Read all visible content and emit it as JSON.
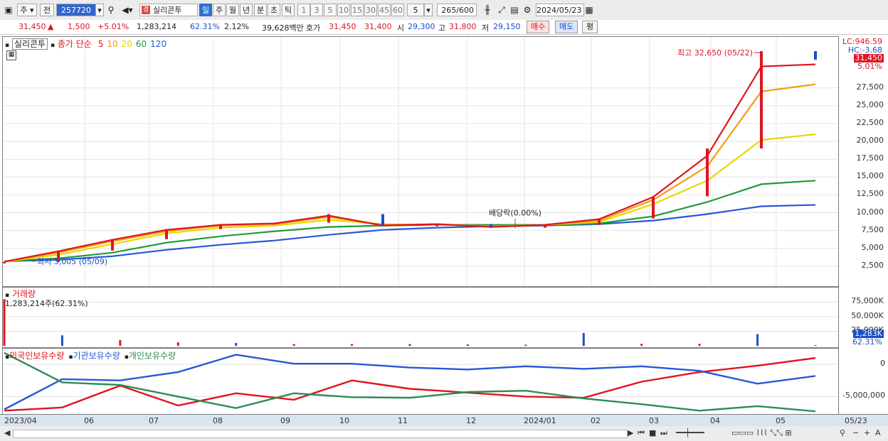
{
  "toolbar": {
    "kind": "주",
    "prev": "전",
    "code": "257720",
    "stock_name": "실리콘투",
    "periods": [
      "일",
      "주",
      "월",
      "년",
      "분",
      "초",
      "틱"
    ],
    "selected_period": "일",
    "intervals": [
      "1",
      "3",
      "5",
      "10",
      "15",
      "30",
      "45",
      "60"
    ],
    "interval_value": "5",
    "count": "265",
    "count_total": "/600",
    "date": "2024/05/23"
  },
  "quote": {
    "price": "31,450",
    "arrow": "▲",
    "change": "1,500",
    "change_pct": "+5.01%",
    "volume": "1,283,214",
    "turnover_pct": "62.31%",
    "ratio": "2.12%",
    "amount": "39,628백만",
    "hoga_label": "호가",
    "ask": "31,450",
    "bid": "31,400",
    "open_label": "시",
    "open": "29,300",
    "high_label": "고",
    "high": "31,800",
    "low_label": "저",
    "low": "29,150",
    "buy_btn": "매수",
    "sell_btn": "매도",
    "eval_btn": "평"
  },
  "price_legend": {
    "name": "실리콘투",
    "ma_label": "종가 단순",
    "ma_periods": [
      {
        "p": "5",
        "color": "#e0141e"
      },
      {
        "p": "10",
        "color": "#f39c12"
      },
      {
        "p": "20",
        "color": "#e6d800"
      },
      {
        "p": "60",
        "color": "#1e9b3a"
      },
      {
        "p": "120",
        "color": "#2a56d6"
      }
    ]
  },
  "price_axis": {
    "lc": "LC:946.59",
    "hc": "HC:-3.68",
    "last": "31,450",
    "pct": "5.01%",
    "ticks": [
      "27,500",
      "25,000",
      "22,500",
      "20,000",
      "17,500",
      "15,000",
      "12,500",
      "10,000",
      "7,500",
      "5,000",
      "2,500"
    ]
  },
  "annotations": {
    "high": "최고 32,650 (05/22)",
    "low": "최저 3,005 (05/09)",
    "dividend": "배당락(0.00%)"
  },
  "volume_pane": {
    "title": "거래량",
    "value": "1,283,214주(62.31%)",
    "ticks": [
      "75,000K",
      "50,000K",
      "25,000K"
    ],
    "last": "1,283K",
    "pct": "62.31%"
  },
  "holdings_pane": {
    "series": [
      {
        "name": "외국인보유수량",
        "color": "#e0141e"
      },
      {
        "name": "기관보유수량",
        "color": "#2a56d6"
      },
      {
        "name": "개인보유수량",
        "color": "#2e8b57"
      }
    ],
    "ticks": [
      "0",
      "-5,000,000"
    ]
  },
  "x_labels": [
    "2023/04",
    "06",
    "07",
    "08",
    "09",
    "10",
    "11",
    "12",
    "2024/01",
    "02",
    "03",
    "04",
    "05",
    "05/23"
  ],
  "chart_data": [
    {
      "type": "line",
      "title": "실리콘투",
      "x": [
        "2023/04",
        "2023/05",
        "2023/06",
        "2023/07",
        "2023/08",
        "2023/09",
        "2023/10",
        "2023/11",
        "2023/12",
        "2024/01",
        "2024/02",
        "2024/03",
        "2024/04",
        "2024/05",
        "2024/05/22",
        "2024/05/23"
      ],
      "series": [
        {
          "name": "종가",
          "values": [
            3100,
            4700,
            6300,
            7700,
            8400,
            8600,
            9800,
            8100,
            8400,
            7900,
            8300,
            9200,
            12300,
            19000,
            32650,
            31450
          ]
        },
        {
          "name": "5",
          "values": [
            3150,
            4600,
            6200,
            7600,
            8300,
            8500,
            9600,
            8200,
            8400,
            8000,
            8300,
            9100,
            12200,
            18000,
            30500,
            30800
          ]
        },
        {
          "name": "10",
          "values": [
            3150,
            4400,
            6000,
            7400,
            8200,
            8400,
            9400,
            8300,
            8400,
            8100,
            8300,
            8900,
            11800,
            16500,
            27000,
            28000
          ]
        },
        {
          "name": "20",
          "values": [
            3150,
            4100,
            5600,
            7100,
            7900,
            8200,
            9000,
            8400,
            8300,
            8100,
            8300,
            8700,
            11200,
            14500,
            20200,
            21000
          ]
        },
        {
          "name": "60",
          "values": [
            3200,
            3600,
            4400,
            5800,
            6700,
            7400,
            8000,
            8200,
            8300,
            8300,
            8300,
            8500,
            9500,
            11500,
            14000,
            14500
          ]
        },
        {
          "name": "120",
          "values": [
            3200,
            3400,
            3900,
            4800,
            5500,
            6100,
            6900,
            7600,
            7900,
            8100,
            8200,
            8400,
            8900,
            9800,
            10900,
            11100
          ]
        }
      ],
      "ylim": [
        0,
        32650
      ]
    },
    {
      "type": "bar",
      "title": "거래량",
      "x": [
        "2023/04",
        "2023/05",
        "2023/06",
        "2023/07",
        "2023/08",
        "2023/09",
        "2023/10",
        "2023/11",
        "2023/12",
        "2024/01",
        "2024/02",
        "2024/03",
        "2024/04",
        "2024/05",
        "2024/05/23"
      ],
      "values_k": [
        80000,
        18000,
        10000,
        6000,
        5000,
        3000,
        3000,
        3000,
        2500,
        2000,
        22000,
        3500,
        3500,
        20000,
        1283
      ],
      "ylim": [
        0,
        90000
      ]
    },
    {
      "type": "line",
      "title": "보유수량",
      "x": [
        "2023/04",
        "2023/05",
        "2023/06",
        "2023/07",
        "2023/08",
        "2023/09",
        "2023/10",
        "2023/11",
        "2023/12",
        "2024/01",
        "2024/02",
        "2024/03",
        "2024/04",
        "2024/05",
        "2024/05/23"
      ],
      "series": [
        {
          "name": "외국인보유수량",
          "values": [
            -7200000,
            -6700000,
            -3300000,
            -6400000,
            -4500000,
            -5500000,
            -2500000,
            -3800000,
            -4400000,
            -5000000,
            -5200000,
            -2700000,
            -1200000,
            -200000,
            1000000
          ]
        },
        {
          "name": "기관보유수량",
          "values": [
            -7000000,
            -2300000,
            -2500000,
            -1200000,
            1500000,
            100000,
            100000,
            -500000,
            -800000,
            -300000,
            -700000,
            -300000,
            -1000000,
            -3000000,
            -1800000
          ]
        },
        {
          "name": "개인보유수량",
          "values": [
            1800000,
            -2800000,
            -3200000,
            -5000000,
            -6800000,
            -4500000,
            -5100000,
            -5200000,
            -4300000,
            -4100000,
            -5300000,
            -6200000,
            -7200000,
            -6500000,
            -7300000
          ]
        }
      ],
      "ylim": [
        -7500000,
        2000000
      ]
    }
  ]
}
